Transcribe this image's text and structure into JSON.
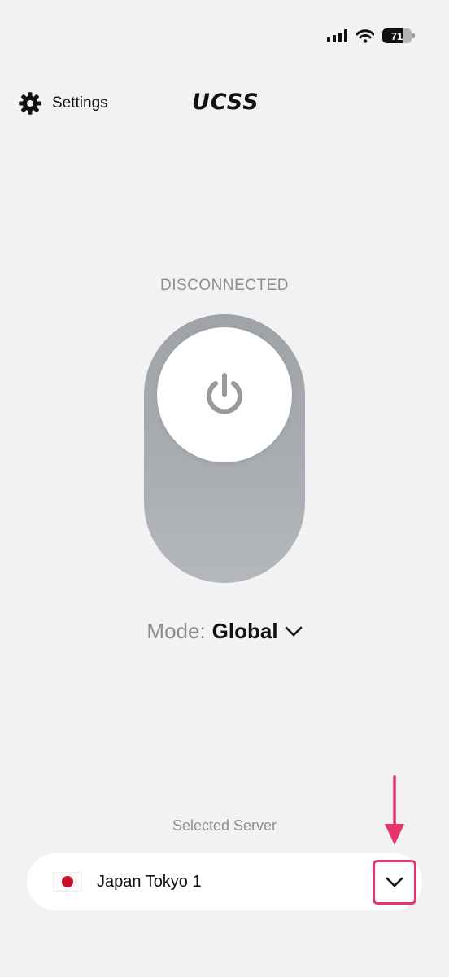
{
  "status_bar": {
    "battery_level": "71",
    "icons": [
      "signal-icon",
      "wifi-icon",
      "battery-icon"
    ]
  },
  "header": {
    "settings_label": "Settings",
    "app_title": "UCSS"
  },
  "connection": {
    "status": "DISCONNECTED",
    "connected": false
  },
  "mode": {
    "label": "Mode:",
    "value": "Global"
  },
  "server": {
    "caption": "Selected Server",
    "name": "Japan Tokyo 1",
    "flag": "japan-flag-icon"
  },
  "colors": {
    "background": "#f2f2f2",
    "toggle_track": "#a9adb2",
    "annotation": "#e8336d",
    "flag_red": "#c8102e"
  }
}
